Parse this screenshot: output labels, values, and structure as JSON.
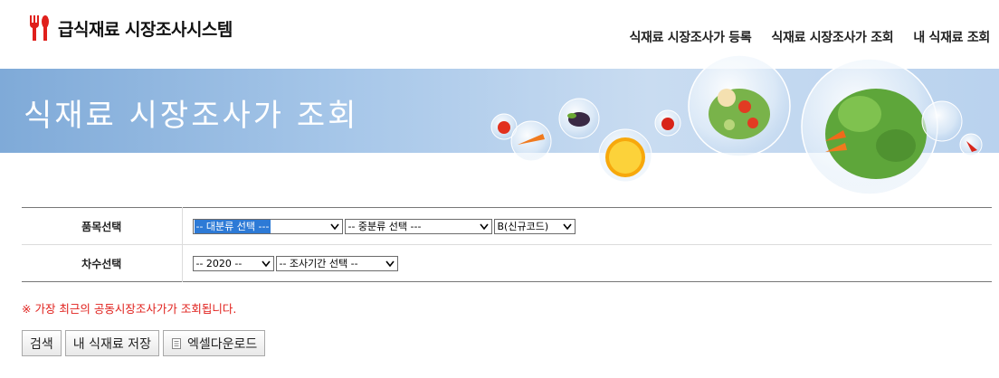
{
  "header": {
    "title": "급식재료 시장조사시스템",
    "nav": [
      "식재료 시장조사가 등록",
      "식재료 시장조사가 조회",
      "내 식재료 조회"
    ]
  },
  "banner": {
    "title": "식재료 시장조사가 조회"
  },
  "search": {
    "rows": [
      {
        "label": "품목선택",
        "selects": [
          {
            "value": "-- 대분류 선택 ---"
          },
          {
            "value": "-- 중분류 선택 ---"
          },
          {
            "value": "B(신규코드)"
          }
        ]
      },
      {
        "label": "차수선택",
        "selects": [
          {
            "value": "-- 2020 --"
          },
          {
            "value": "-- 조사기간 선택 --"
          }
        ]
      }
    ]
  },
  "notice": "※ 가장 최근의 공동시장조사가가 조회됩니다.",
  "buttons": {
    "search": "검색",
    "save": "내 식재료 저장",
    "excel": "엑셀다운로드"
  },
  "colors": {
    "notice": "#e0201c",
    "banner": "#a7c7e9",
    "select_highlight": "#2d7ad6"
  }
}
